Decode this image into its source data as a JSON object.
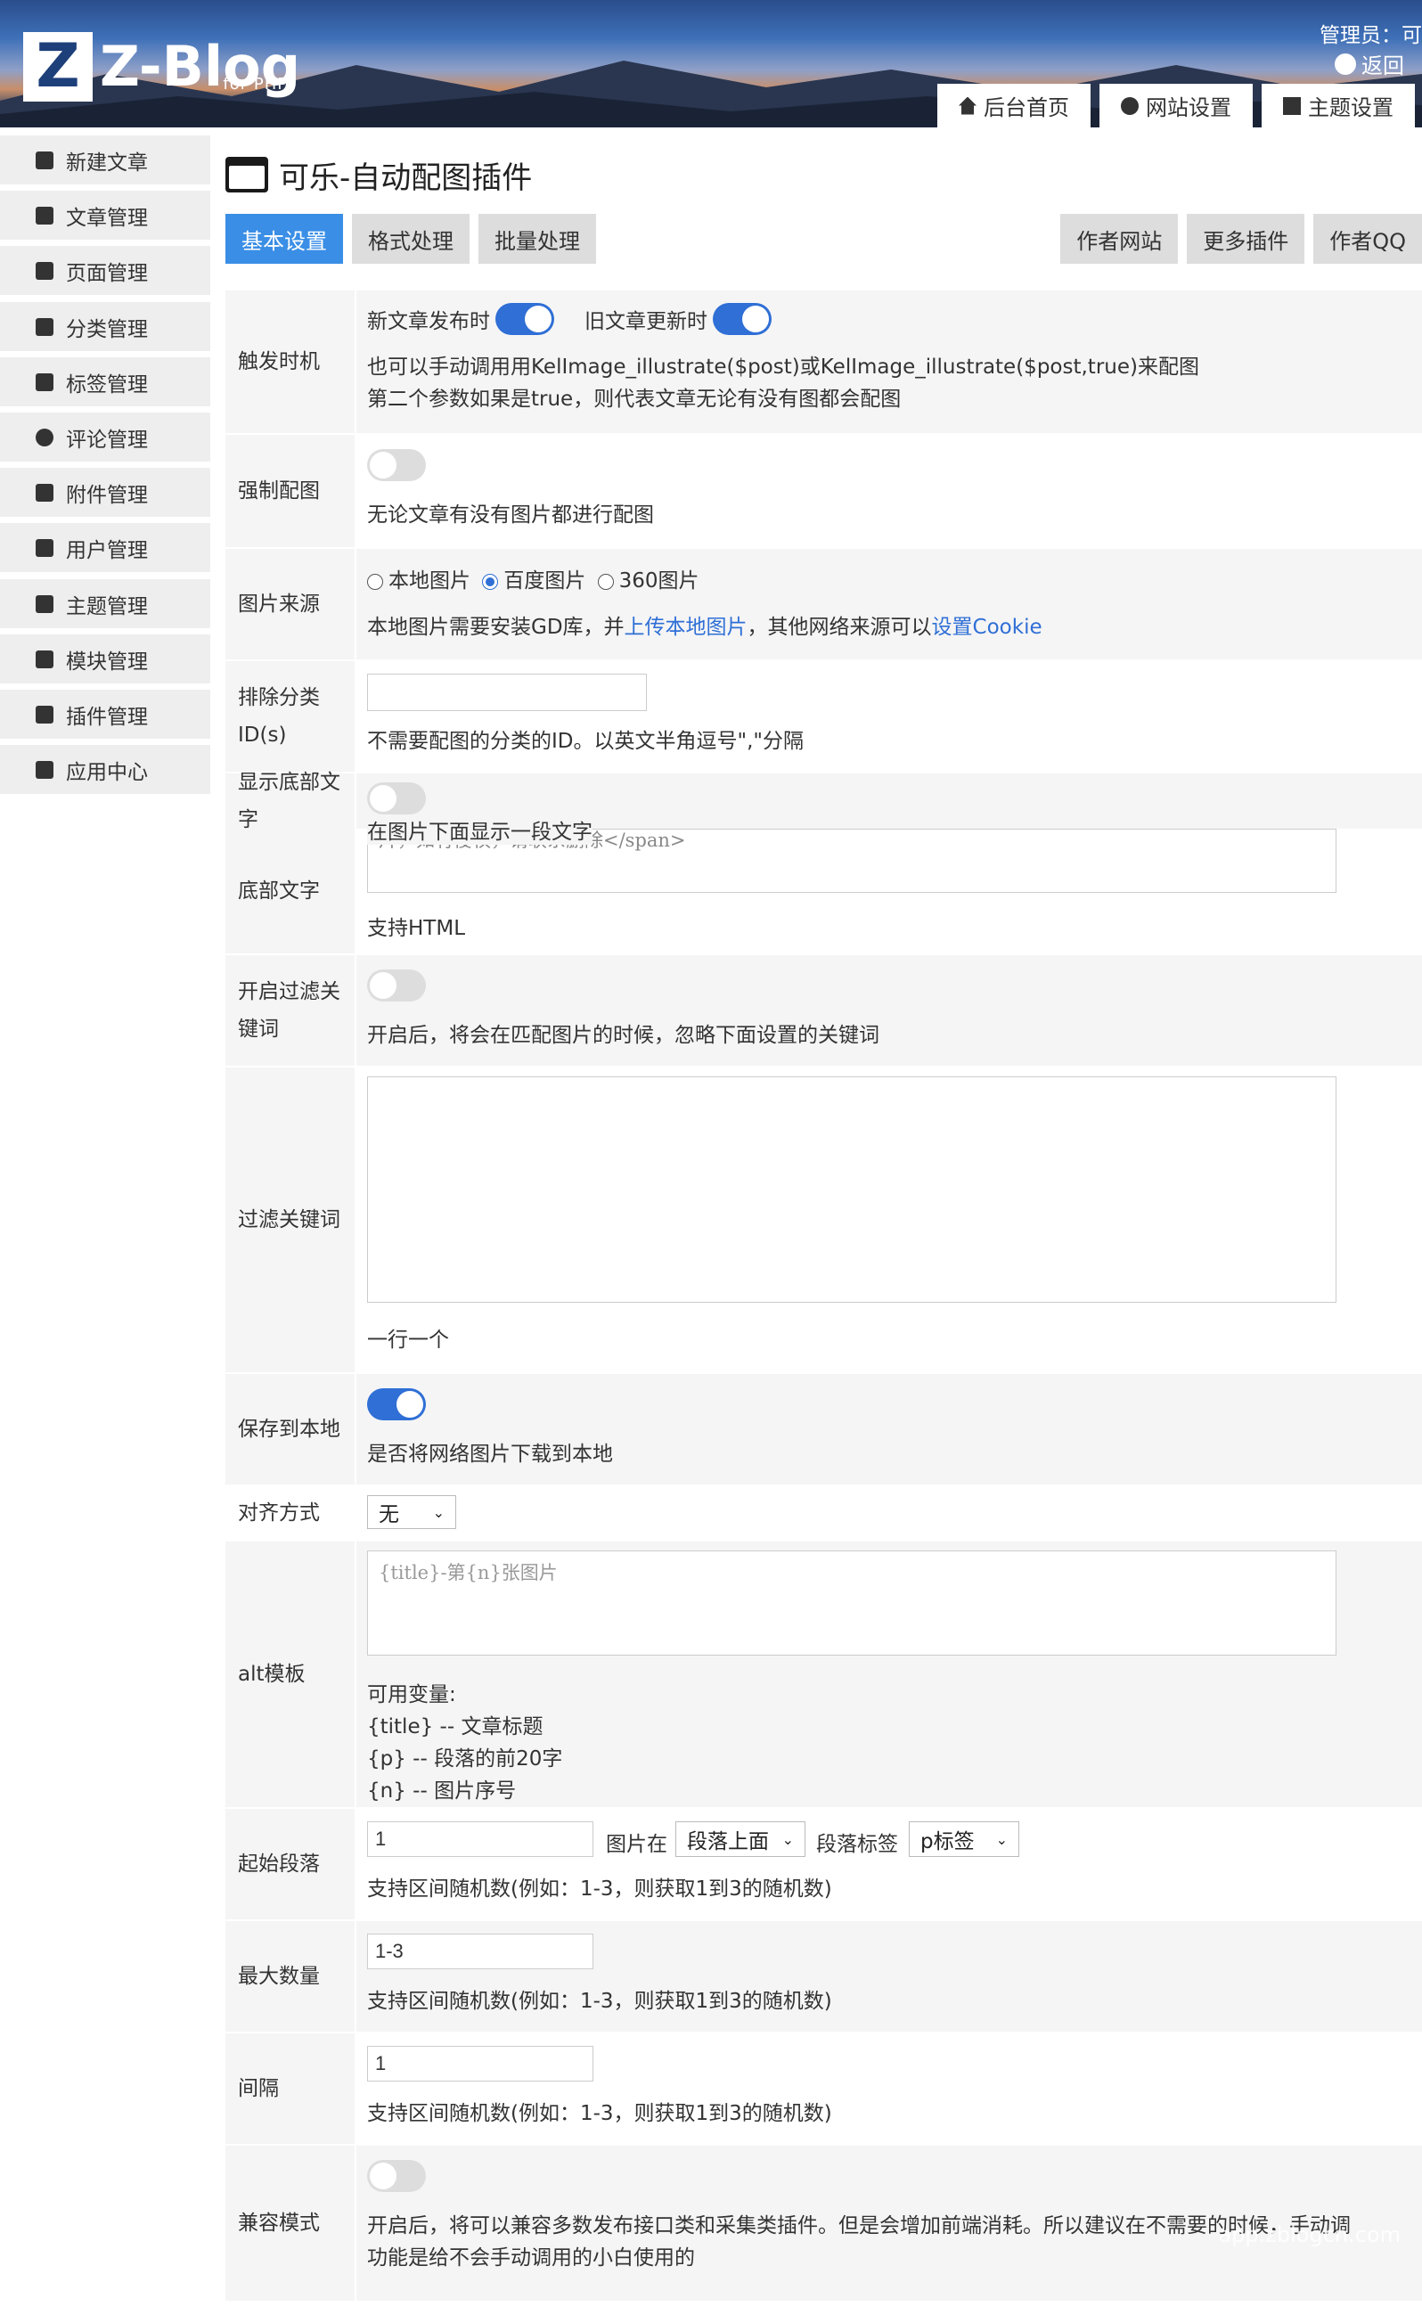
{
  "header": {
    "logo_letter": "Z",
    "logo_text": "Z-Blog",
    "logo_sub": "for PHP",
    "admin_label": "管理员：可",
    "back_label": "返回",
    "nav": [
      {
        "label": "后台首页",
        "icon": "home-icon"
      },
      {
        "label": "网站设置",
        "icon": "gear-icon"
      },
      {
        "label": "主题设置",
        "icon": "layout-icon"
      }
    ]
  },
  "sidebar": {
    "items": [
      {
        "label": "新建文章",
        "icon": "edit-icon"
      },
      {
        "label": "文章管理",
        "icon": "article-icon"
      },
      {
        "label": "页面管理",
        "icon": "page-icon"
      },
      {
        "label": "分类管理",
        "icon": "folder-icon"
      },
      {
        "label": "标签管理",
        "icon": "tag-icon"
      },
      {
        "label": "评论管理",
        "icon": "comment-icon"
      },
      {
        "label": "附件管理",
        "icon": "attachment-icon"
      },
      {
        "label": "用户管理",
        "icon": "users-icon"
      },
      {
        "label": "主题管理",
        "icon": "theme-icon"
      },
      {
        "label": "模块管理",
        "icon": "grid-icon"
      },
      {
        "label": "插件管理",
        "icon": "puzzle-icon"
      },
      {
        "label": "应用中心",
        "icon": "box-icon"
      }
    ]
  },
  "page": {
    "title": "可乐-自动配图插件",
    "tabs": [
      "基本设置",
      "格式处理",
      "批量处理"
    ],
    "right_tabs": [
      "作者网站",
      "更多插件",
      "作者QQ"
    ]
  },
  "form": {
    "trigger": {
      "label": "触发时机",
      "new_post": "新文章发布时",
      "old_post": "旧文章更新时",
      "help1": "也可以手动调用用KelImage_illustrate($post)或KelImage_illustrate($post,true)来配图",
      "help2": "第二个参数如果是true，则代表文章无论有没有图都会配图"
    },
    "force": {
      "label": "强制配图",
      "help": "无论文章有没有图片都进行配图"
    },
    "source": {
      "label": "图片来源",
      "options": [
        "本地图片",
        "百度图片",
        "360图片"
      ],
      "selected": "百度图片",
      "help_a": "本地图片需要安装GD库，并",
      "help_link1": "上传本地图片",
      "help_b": "，其他网络来源可以",
      "help_link2": "设置Cookie"
    },
    "exclude": {
      "label": "排除分类ID(s)",
      "value": "",
      "help": "不需要配图的分类的ID。以英文半角逗号\",\"分隔"
    },
    "show_footer": {
      "label": "显示底部文字",
      "help": "在图片下面显示一段文字"
    },
    "footer_text": {
      "label": "底部文字",
      "value": "片，如有侵权，请联系删除</span>",
      "help": "支持HTML"
    },
    "filter_on": {
      "label": "开启过滤关键词",
      "help": "开启后，将会在匹配图片的时候，忽略下面设置的关键词"
    },
    "filter_words": {
      "label": "过滤关键词",
      "value": "",
      "help": "一行一个"
    },
    "save_local": {
      "label": "保存到本地",
      "help": "是否将网络图片下载到本地"
    },
    "align": {
      "label": "对齐方式",
      "value": "无"
    },
    "alt": {
      "label": "alt模板",
      "value": "{title}-第{n}张图片",
      "vars_title": "可用变量:",
      "v1": "{title} -- 文章标题",
      "v2": "{p} -- 段落的前20字",
      "v3": "{n} -- 图片序号"
    },
    "start": {
      "label": "起始段落",
      "value": "1",
      "pos_label": "图片在",
      "pos_value": "段落上面",
      "tag_label": "段落标签",
      "tag_value": "p标签",
      "help": "支持区间随机数(例如：1-3，则获取1到3的随机数)"
    },
    "max": {
      "label": "最大数量",
      "value": "1-3",
      "help": "支持区间随机数(例如：1-3，则获取1到3的随机数)"
    },
    "interval": {
      "label": "间隔",
      "value": "1",
      "help": "支持区间随机数(例如：1-3，则获取1到3的随机数)"
    },
    "compat": {
      "label": "兼容模式",
      "help1": "开启后，将可以兼容多数发布接口类和采集类插件。但是会增加前端消耗。所以建议在不需要的时候，手动调",
      "help2": "功能是给不会手动调用的小白使用的"
    }
  },
  "watermark": "app.zblogcn.com"
}
